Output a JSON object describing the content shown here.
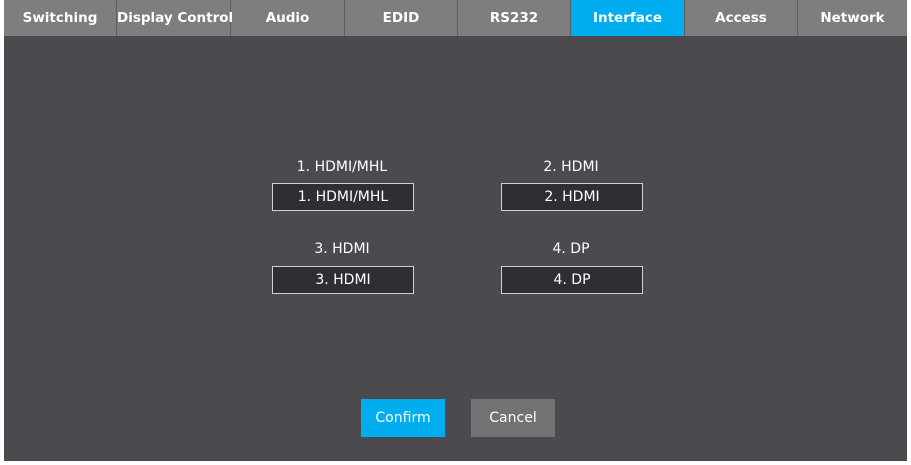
{
  "tabs": [
    {
      "label": "Switching",
      "active": false
    },
    {
      "label": "Display Control",
      "active": false
    },
    {
      "label": "Audio",
      "active": false
    },
    {
      "label": "EDID",
      "active": false
    },
    {
      "label": "RS232",
      "active": false
    },
    {
      "label": "Interface",
      "active": true
    },
    {
      "label": "Access",
      "active": false
    },
    {
      "label": "Network",
      "active": false
    }
  ],
  "interfaces": [
    {
      "label": "1. HDMI/MHL",
      "value": "1. HDMI/MHL"
    },
    {
      "label": "2. HDMI",
      "value": "2. HDMI"
    },
    {
      "label": "3. HDMI",
      "value": "3. HDMI"
    },
    {
      "label": "4. DP",
      "value": "4. DP"
    }
  ],
  "buttons": {
    "confirm_label": "Confirm",
    "cancel_label": "Cancel"
  },
  "colors": {
    "accent": "#00aeef",
    "background": "#4a4a4f",
    "tabbar": "#7e7e7e",
    "input_bg": "#2f2f33",
    "cancel": "#727272"
  }
}
